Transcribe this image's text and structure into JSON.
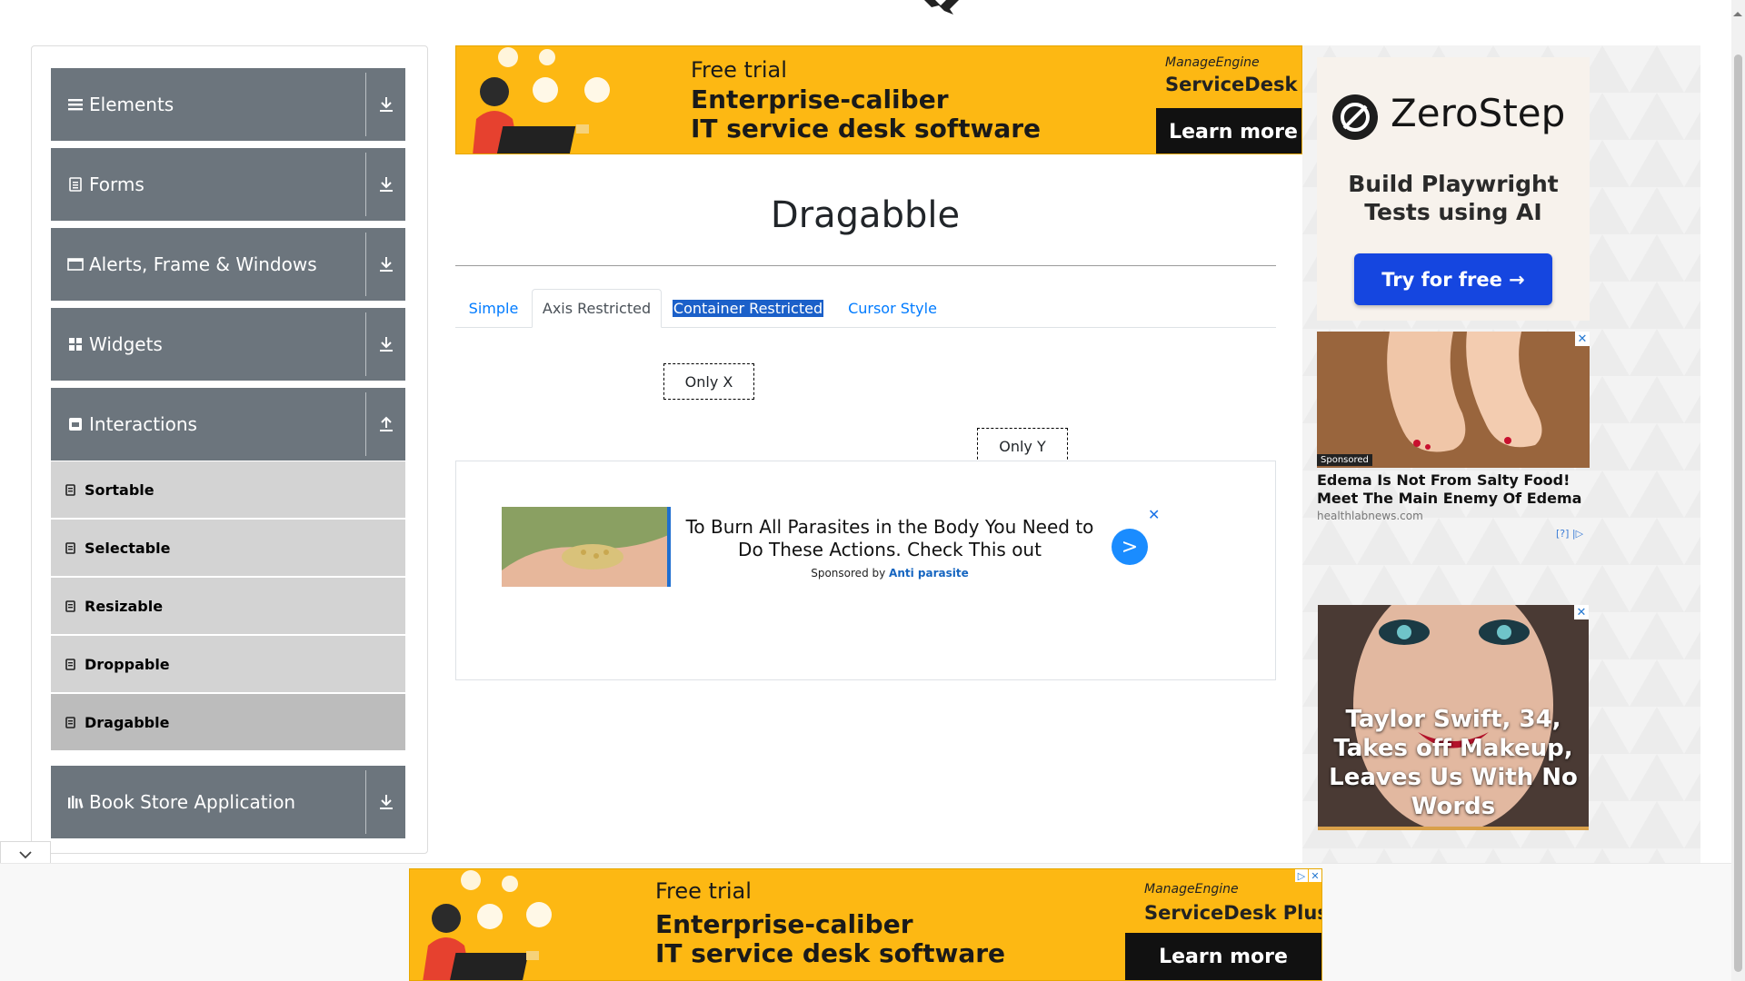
{
  "sidebar": {
    "groups": [
      {
        "label": "Elements",
        "icon": "hamburger-icon",
        "toggle": "download-icon"
      },
      {
        "label": "Forms",
        "icon": "document-icon",
        "toggle": "download-icon"
      },
      {
        "label": "Alerts, Frame & Windows",
        "icon": "window-icon",
        "toggle": "download-icon"
      },
      {
        "label": "Widgets",
        "icon": "grid-icon",
        "toggle": "download-icon"
      },
      {
        "label": "Interactions",
        "icon": "interactions-icon",
        "toggle": "upload-icon"
      },
      {
        "label": "Book Store Application",
        "icon": "books-icon",
        "toggle": "download-icon"
      }
    ],
    "items": [
      {
        "label": "Sortable"
      },
      {
        "label": "Selectable"
      },
      {
        "label": "Resizable"
      },
      {
        "label": "Droppable"
      },
      {
        "label": "Dragabble",
        "active": true
      }
    ]
  },
  "top_ad": {
    "line1": "Free trial",
    "line2": "Enterprise-caliber",
    "line3": "IT service desk software",
    "brand_small": "ManageEngine",
    "brand_big": "ServiceDesk Pl",
    "cta": "Learn more"
  },
  "main": {
    "title": "Dragabble",
    "tabs": [
      {
        "label": "Simple"
      },
      {
        "label": "Axis Restricted",
        "active": true
      },
      {
        "label": "Container Restricted",
        "selected": true
      },
      {
        "label": "Cursor Style"
      }
    ],
    "drag_x": "Only X",
    "drag_y": "Only Y"
  },
  "native_ad": {
    "headline": "To Burn All Parasites in the Body You Need to Do These Actions. Check This out",
    "sponsored_by": "Sponsored by",
    "sponsor": "Anti parasite",
    "cta": ">",
    "close": "✕"
  },
  "right_rail": {
    "zerostep": {
      "brand": "ZeroStep",
      "tagline": "Build Playwright Tests using AI",
      "cta": "Try for free →"
    },
    "ad1": {
      "badge": "Sponsored",
      "headline": "Edema Is Not From Salty Food! Meet The Main Enemy Of Edema",
      "domain": "healthlabnews.com",
      "choices": "[?] |▷"
    },
    "ad2": {
      "headline": "Taylor Swift, 34, Takes off Makeup, Leaves Us With No Words"
    }
  },
  "bottom_ad": {
    "line1": "Free trial",
    "line2": "Enterprise-caliber",
    "line3": "IT service desk software",
    "brand_small": "ManageEngine",
    "brand_big": "ServiceDesk Plus",
    "cta": "Learn more"
  },
  "colors": {
    "sidebar_header": "#6c757d",
    "sidebar_item": "#d3d3d3",
    "link": "#007bff",
    "ad_yellow": "#fdb813",
    "zerostep_button": "#1546e0"
  }
}
